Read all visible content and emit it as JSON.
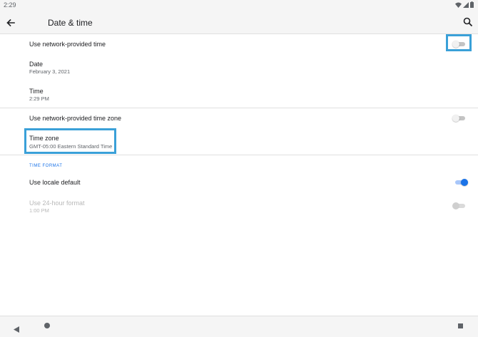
{
  "status_bar": {
    "time": "2:29",
    "icons": [
      "wifi-icon",
      "signal-icon",
      "battery-icon"
    ]
  },
  "app_bar": {
    "title": "Date & time",
    "back_icon": "arrow-left-icon",
    "search_icon": "search-icon"
  },
  "settings": {
    "network_time": {
      "title": "Use network-provided time",
      "enabled": false
    },
    "date": {
      "title": "Date",
      "value": "February 3, 2021"
    },
    "time": {
      "title": "Time",
      "value": "2:29 PM"
    },
    "network_timezone": {
      "title": "Use network-provided time zone",
      "enabled": false
    },
    "timezone": {
      "title": "Time zone",
      "value": "GMT-05:00 Eastern Standard Time"
    }
  },
  "time_format": {
    "header": "TIME FORMAT",
    "locale_default": {
      "title": "Use locale default",
      "enabled": true
    },
    "hour24": {
      "title": "Use 24-hour format",
      "value": "1:00 PM",
      "enabled": false,
      "disabled": true
    }
  },
  "colors": {
    "accent": "#1a73e8",
    "highlight": "#3aa0d8"
  }
}
